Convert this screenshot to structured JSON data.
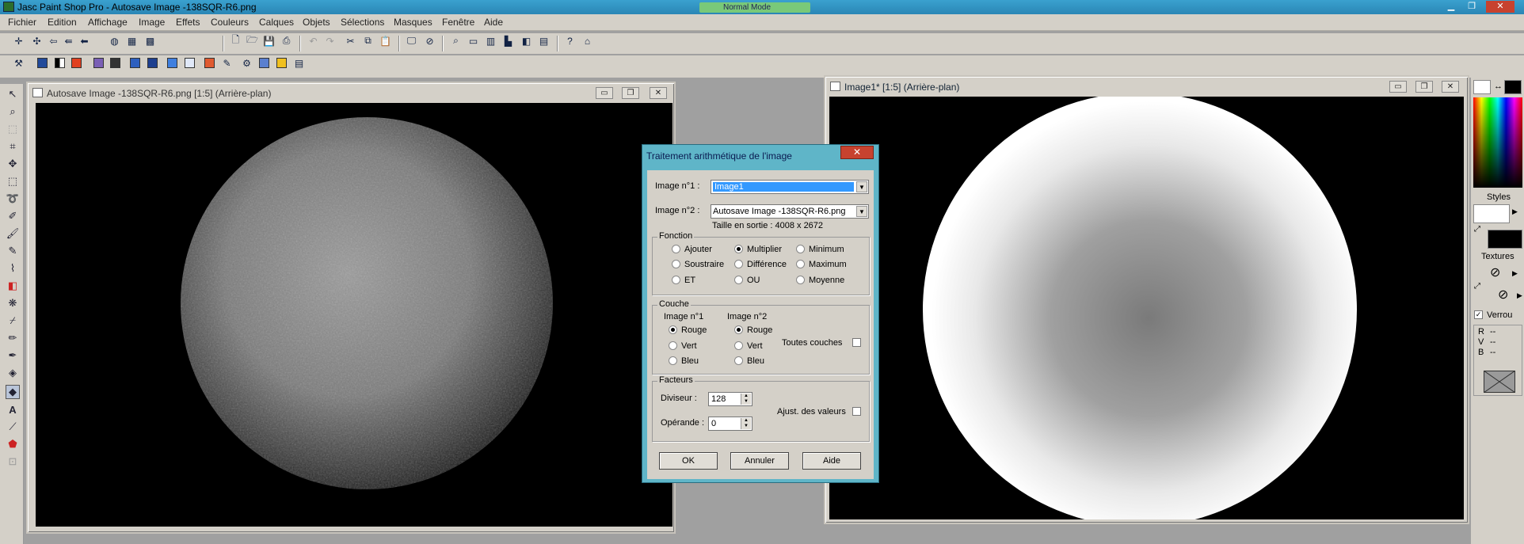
{
  "window": {
    "title": "Jasc Paint Shop Pro - Autosave Image -138SQR-R6.png",
    "taskbar_hint": "Normal Mode"
  },
  "menu": [
    "Fichier",
    "Edition",
    "Affichage",
    "Image",
    "Effets",
    "Couleurs",
    "Calques",
    "Objets",
    "Sélections",
    "Masques",
    "Fenêtre",
    "Aide"
  ],
  "doc1": {
    "title": "Autosave Image -138SQR-R6.png [1:5] (Arrière-plan)"
  },
  "doc2": {
    "title": "Image1* [1:5] (Arrière-plan)"
  },
  "dialog": {
    "title": "Traitement arithmétique de l'image",
    "close": "✕",
    "image1_label": "Image n°1 :",
    "image1_value": "Image1",
    "image2_label": "Image n°2 :",
    "image2_value": "Autosave Image -138SQR-R6.png",
    "output_size": "Taille en sortie : 4008 x 2672",
    "fonction": {
      "legend": "Fonction",
      "options": [
        "Ajouter",
        "Multiplier",
        "Minimum",
        "Soustraire",
        "Différence",
        "Maximum",
        "ET",
        "OU",
        "Moyenne"
      ],
      "selected": "Multiplier"
    },
    "couche": {
      "legend": "Couche",
      "col1": "Image n°1",
      "col2": "Image n°2",
      "options": [
        "Rouge",
        "Vert",
        "Bleu"
      ],
      "selected1": "Rouge",
      "selected2": "Rouge",
      "all_layers": "Toutes couches",
      "all_layers_checked": false
    },
    "facteurs": {
      "legend": "Facteurs",
      "divisor_label": "Diviseur :",
      "divisor": "128",
      "operand_label": "Opérande :",
      "operand": "0",
      "adjust_label": "Ajust. des valeurs",
      "adjust_checked": false
    },
    "buttons": {
      "ok": "OK",
      "cancel": "Annuler",
      "help": "Aide"
    }
  },
  "palette": {
    "styles": "Styles",
    "textures": "Textures",
    "lock": "Verrou",
    "lock_checked": true,
    "r": "R",
    "v": "V",
    "b": "B",
    "r_val": "--",
    "v_val": "--",
    "b_val": "--"
  }
}
